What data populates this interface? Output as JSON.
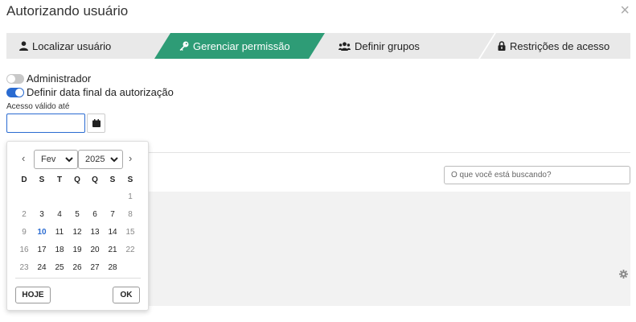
{
  "modal": {
    "title": "Autorizando usuário"
  },
  "wizard": {
    "steps": [
      {
        "label": "Localizar usuário",
        "icon": "user-icon"
      },
      {
        "label": "Gerenciar permissão",
        "icon": "key-icon"
      },
      {
        "label": "Definir grupos",
        "icon": "users-icon"
      },
      {
        "label": "Restrições de acesso",
        "icon": "lock-icon"
      }
    ],
    "active_index": 1
  },
  "colors": {
    "active_step": "#2e9c76",
    "accent": "#2a6bd1"
  },
  "toggles": [
    {
      "label": "Administrador",
      "on": false
    },
    {
      "label": "Definir data final da autorização",
      "on": true
    }
  ],
  "access": {
    "label": "Acesso válido até",
    "value": ""
  },
  "search": {
    "placeholder": "O que você está buscando?"
  },
  "datepicker": {
    "month": "Fev",
    "year": "2025",
    "weekdays": [
      "D",
      "S",
      "T",
      "Q",
      "Q",
      "S",
      "S"
    ],
    "days": [
      "1",
      "2",
      "3",
      "4",
      "5",
      "6",
      "7",
      "8",
      "9",
      "10",
      "11",
      "12",
      "13",
      "14",
      "15",
      "16",
      "17",
      "18",
      "19",
      "20",
      "21",
      "22",
      "23",
      "24",
      "25",
      "26",
      "27",
      "28"
    ],
    "today": "10",
    "prev_label": "‹",
    "next_label": "›",
    "today_button": "HOJE",
    "ok_button": "OK"
  }
}
